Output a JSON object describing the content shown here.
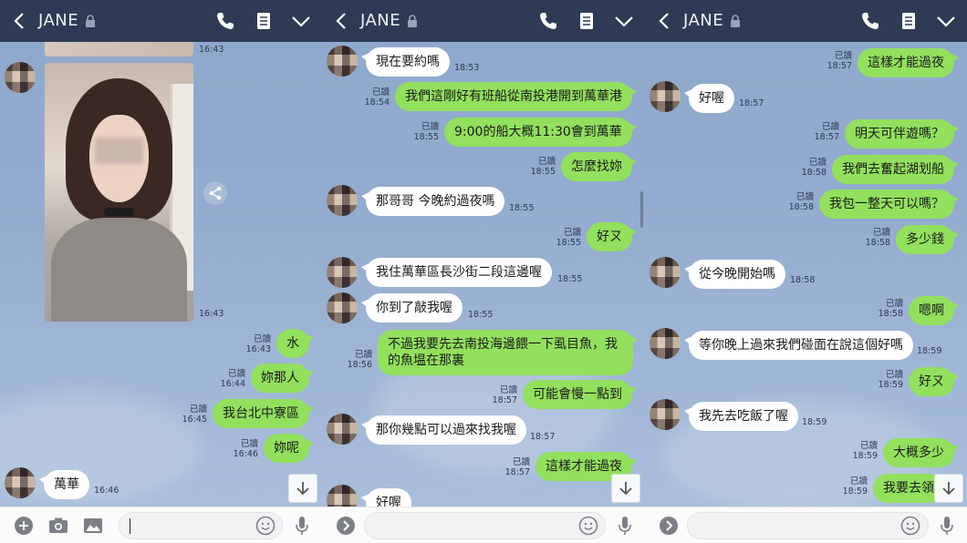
{
  "panels": [
    {
      "header": {
        "title": "JANE"
      },
      "photo_time": "16:43",
      "top_time": "16:43",
      "messages": [
        {
          "dir": "out",
          "text": "水",
          "read": "已讀",
          "time": "16:43"
        },
        {
          "dir": "out",
          "text": "妳那人",
          "read": "已讀",
          "time": "16:44"
        },
        {
          "dir": "out",
          "text": "我台北中寮區",
          "read": "已讀",
          "time": "16:45"
        },
        {
          "dir": "out",
          "text": "妳呢",
          "read": "已讀",
          "time": "16:46"
        },
        {
          "dir": "in",
          "text": "萬華",
          "time": "16:46"
        }
      ]
    },
    {
      "header": {
        "title": "JANE"
      },
      "messages": [
        {
          "dir": "in",
          "text": "現在要約嗎",
          "time": "18:53"
        },
        {
          "dir": "out",
          "text": "我們這剛好有班船從南投港開到萬華港",
          "read": "已讀",
          "time": "18:54"
        },
        {
          "dir": "out",
          "text": "9:00的船大概11:30會到萬華",
          "read": "已讀",
          "time": "18:55"
        },
        {
          "dir": "out",
          "text": "怎麼找妳",
          "read": "已讀",
          "time": "18:55"
        },
        {
          "dir": "in",
          "text": "那哥哥 今晚約過夜嗎",
          "time": "18:55"
        },
        {
          "dir": "out",
          "text": "好ㄡ",
          "read": "已讀",
          "time": "18:55"
        },
        {
          "dir": "in",
          "text": "我住萬華區長沙街二段這邊喔",
          "time": "18:55"
        },
        {
          "dir": "in",
          "text": "你到了敲我喔",
          "time": "18:55"
        },
        {
          "dir": "out",
          "text": "不過我要先去南投海邊餵一下虱目魚，我的魚塭在那裏",
          "read": "已讀",
          "time": "18:56"
        },
        {
          "dir": "out",
          "text": "可能會慢一點到",
          "read": "已讀",
          "time": "18:57"
        },
        {
          "dir": "in",
          "text": "那你幾點可以過來找我喔",
          "time": "18:57"
        },
        {
          "dir": "out",
          "text": "這樣才能過夜",
          "read": "已讀",
          "time": "18:57"
        },
        {
          "dir": "in",
          "text": "好喔",
          "time": ""
        }
      ]
    },
    {
      "header": {
        "title": "JANE"
      },
      "messages": [
        {
          "dir": "out",
          "text": "這樣才能過夜",
          "read": "已讀",
          "time": "18:57"
        },
        {
          "dir": "in",
          "text": "好喔",
          "time": "18:57"
        },
        {
          "dir": "out",
          "text": "明天可伴遊嗎？",
          "read": "已讀",
          "time": "18:57"
        },
        {
          "dir": "out",
          "text": "我們去奮起湖划船",
          "read": "已讀",
          "time": "18:58"
        },
        {
          "dir": "out",
          "text": "我包一整天可以嗎？",
          "read": "已讀",
          "time": "18:58"
        },
        {
          "dir": "out",
          "text": "多少錢",
          "read": "已讀",
          "time": "18:58"
        },
        {
          "dir": "in",
          "text": "從今晚開始嗎",
          "time": "18:58"
        },
        {
          "dir": "out",
          "text": "嗯啊",
          "read": "已讀",
          "time": "18:58"
        },
        {
          "dir": "in",
          "text": "等你晚上過來我們碰面在說這個好嗎",
          "time": "18:59"
        },
        {
          "dir": "out",
          "text": "好ㄡ",
          "read": "已讀",
          "time": "18:59"
        },
        {
          "dir": "in",
          "text": "我先去吃飯了喔",
          "time": "18:59"
        },
        {
          "dir": "out",
          "text": "大概多少",
          "read": "已讀",
          "time": "18:59"
        },
        {
          "dir": "out",
          "text": "我要去領",
          "read": "已讀",
          "time": "18:59"
        }
      ]
    }
  ],
  "colors": {
    "header_bg": "#2f3b55",
    "out_bubble": "#92e05e",
    "in_bubble": "#ffffff",
    "chat_bg": "#93abce"
  },
  "icons": [
    "chevron-left-icon",
    "lock-icon",
    "phone-icon",
    "notes-icon",
    "chevron-down-icon",
    "share-icon",
    "arrow-down-icon",
    "plus-icon",
    "camera-icon",
    "image-icon",
    "emoji-icon",
    "mic-icon",
    "chevron-right-icon"
  ]
}
